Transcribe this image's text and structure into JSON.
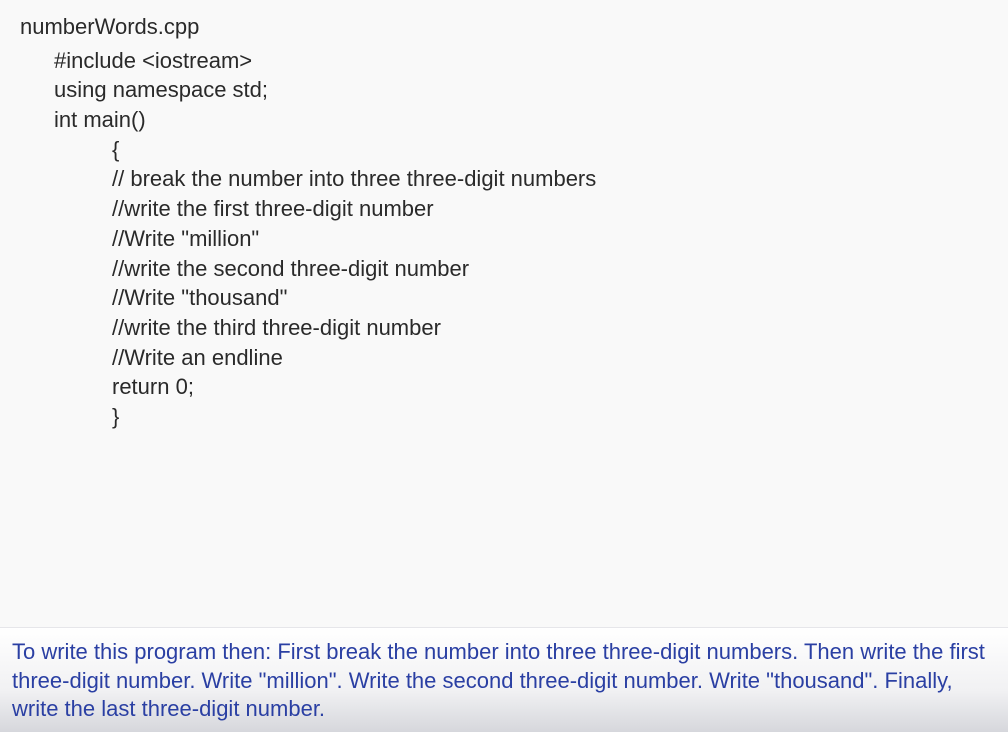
{
  "filename": "numberWords.cpp",
  "code": {
    "line1": "#include <iostream>",
    "line2": "using namespace std;",
    "line3": "int main()",
    "line4": "{",
    "line5": "// break the number into three three-digit numbers",
    "line6": "//write the first three-digit number",
    "line7": "//Write \"million\"",
    "line8": "//write the second three-digit number",
    "line9": "//Write \"thousand\"",
    "line10": "//write the third three-digit number",
    "line11": "//Write an endline",
    "line12": "return 0;",
    "line13": "}"
  },
  "caption": "To write this program then:  First break the number into three three-digit numbers.  Then write the first three-digit number.  Write \"million\".  Write the second three-digit number.  Write \"thousand\".  Finally, write the last three-digit number."
}
